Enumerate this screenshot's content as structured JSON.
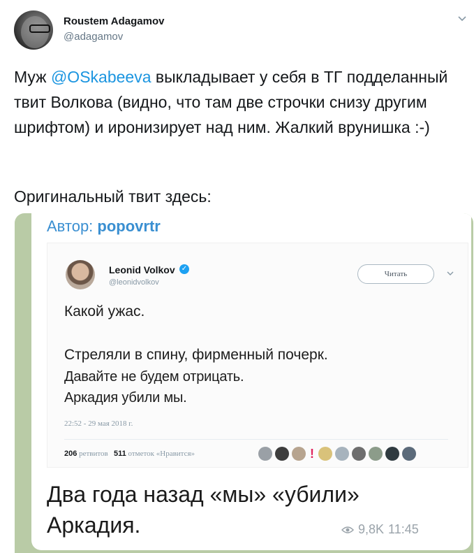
{
  "tweet": {
    "author_name": "Roustem Adagamov",
    "author_handle": "@adagamov",
    "text_prefix": "Муж ",
    "mention": "@OSkabeeva",
    "text_suffix": " выкладывает у себя в ТГ подделанный твит Волкова (видно, что там две строчки снизу другим шрифтом) и иронизирует над ним. Жалкий врунишка :-)",
    "text_line2": "Оригинальный твит здесь:"
  },
  "telegram": {
    "author_label": "Автор: ",
    "author_name": "popovrtr",
    "caption": "Два года назад «мы» «убили» Аркадия.",
    "views": "9,8K",
    "time": "11:45"
  },
  "embedded_tweet": {
    "name": "Leonid Volkov",
    "handle": "@leonidvolkov",
    "follow_label": "Читать",
    "line1": "Какой ужас.",
    "line2": "Стреляли в спину, фирменный почерк.",
    "line3": "Давайте не будем отрицать.",
    "line4": "Аркадия убили мы.",
    "timestamp": "22:52 - 29 мая 2018 г.",
    "retweets_count": "206",
    "retweets_label": "ретвитов",
    "likes_count": "511",
    "likes_label": "отметок «Нравится»"
  },
  "colors": {
    "mention": "#1b95e0",
    "telegram_author": "#3a8fd1",
    "verified": "#1da1f2",
    "chat_background": "#b9cba6"
  },
  "icons": {
    "caret": "chevron-down-icon",
    "verified": "verified-badge-icon",
    "views": "eye-icon"
  }
}
